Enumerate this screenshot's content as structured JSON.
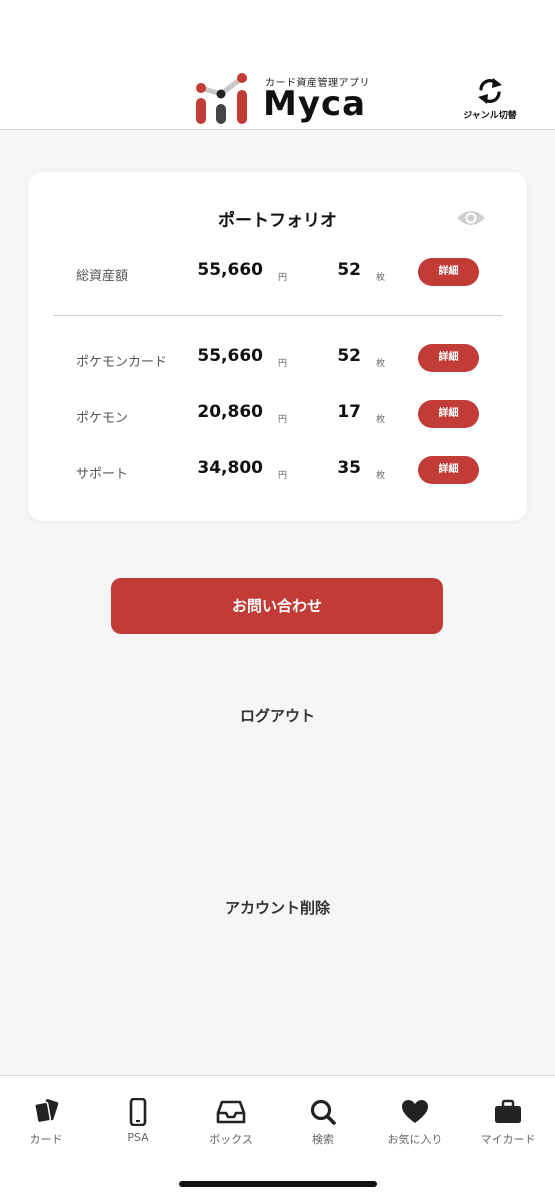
{
  "header": {
    "logo_tagline": "カード資産管理アプリ",
    "logo_name": "Myca",
    "genre_switch_label": "ジャンル切替",
    "accent_color": "#c13b37"
  },
  "portfolio": {
    "title": "ポートフォリオ",
    "yen_unit": "円",
    "count_unit": "枚",
    "detail_label": "詳細",
    "total": {
      "label": "総資産額",
      "amount": "55,660",
      "count": "52"
    },
    "rows": [
      {
        "label": "ポケモンカード",
        "amount": "55,660",
        "count": "52"
      },
      {
        "label": "ポケモン",
        "amount": "20,860",
        "count": "17"
      },
      {
        "label": "サポート",
        "amount": "34,800",
        "count": "35"
      }
    ]
  },
  "actions": {
    "contact_label": "お問い合わせ",
    "logout_label": "ログアウト",
    "delete_account_label": "アカウント削除"
  },
  "tabbar": {
    "items": [
      {
        "label": "カード",
        "icon": "cards-icon"
      },
      {
        "label": "PSA",
        "icon": "phone-icon"
      },
      {
        "label": "ボックス",
        "icon": "inbox-icon"
      },
      {
        "label": "検索",
        "icon": "search-icon"
      },
      {
        "label": "お気に入り",
        "icon": "heart-icon"
      },
      {
        "label": "マイカード",
        "icon": "briefcase-icon"
      }
    ]
  }
}
